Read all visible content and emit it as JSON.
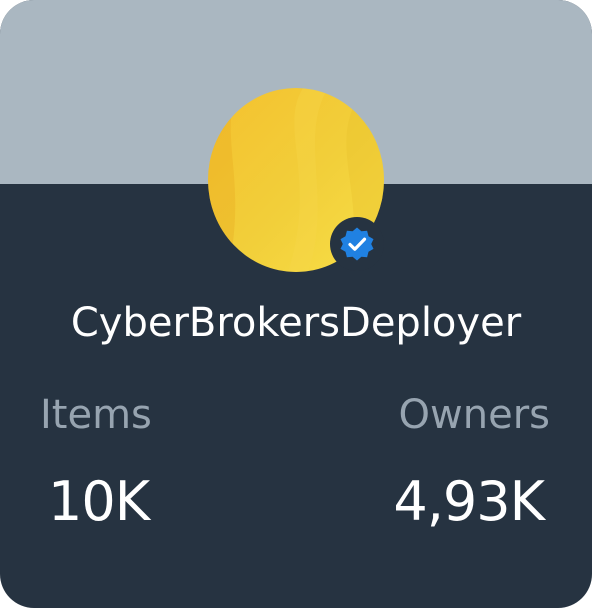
{
  "profile": {
    "name": "CyberBrokersDeployer",
    "verified_icon": "verified-badge-icon",
    "avatar_icon": "avatar-image"
  },
  "stats": {
    "items_label": "Items",
    "items_value": "10K",
    "owners_label": "Owners",
    "owners_value": "4,93K"
  },
  "colors": {
    "banner": "#aab7c1",
    "card_background": "#263341",
    "label": "#97a4b0",
    "value": "#ffffff",
    "verified": "#2081e2",
    "avatar_yellow": "#f2c436"
  }
}
